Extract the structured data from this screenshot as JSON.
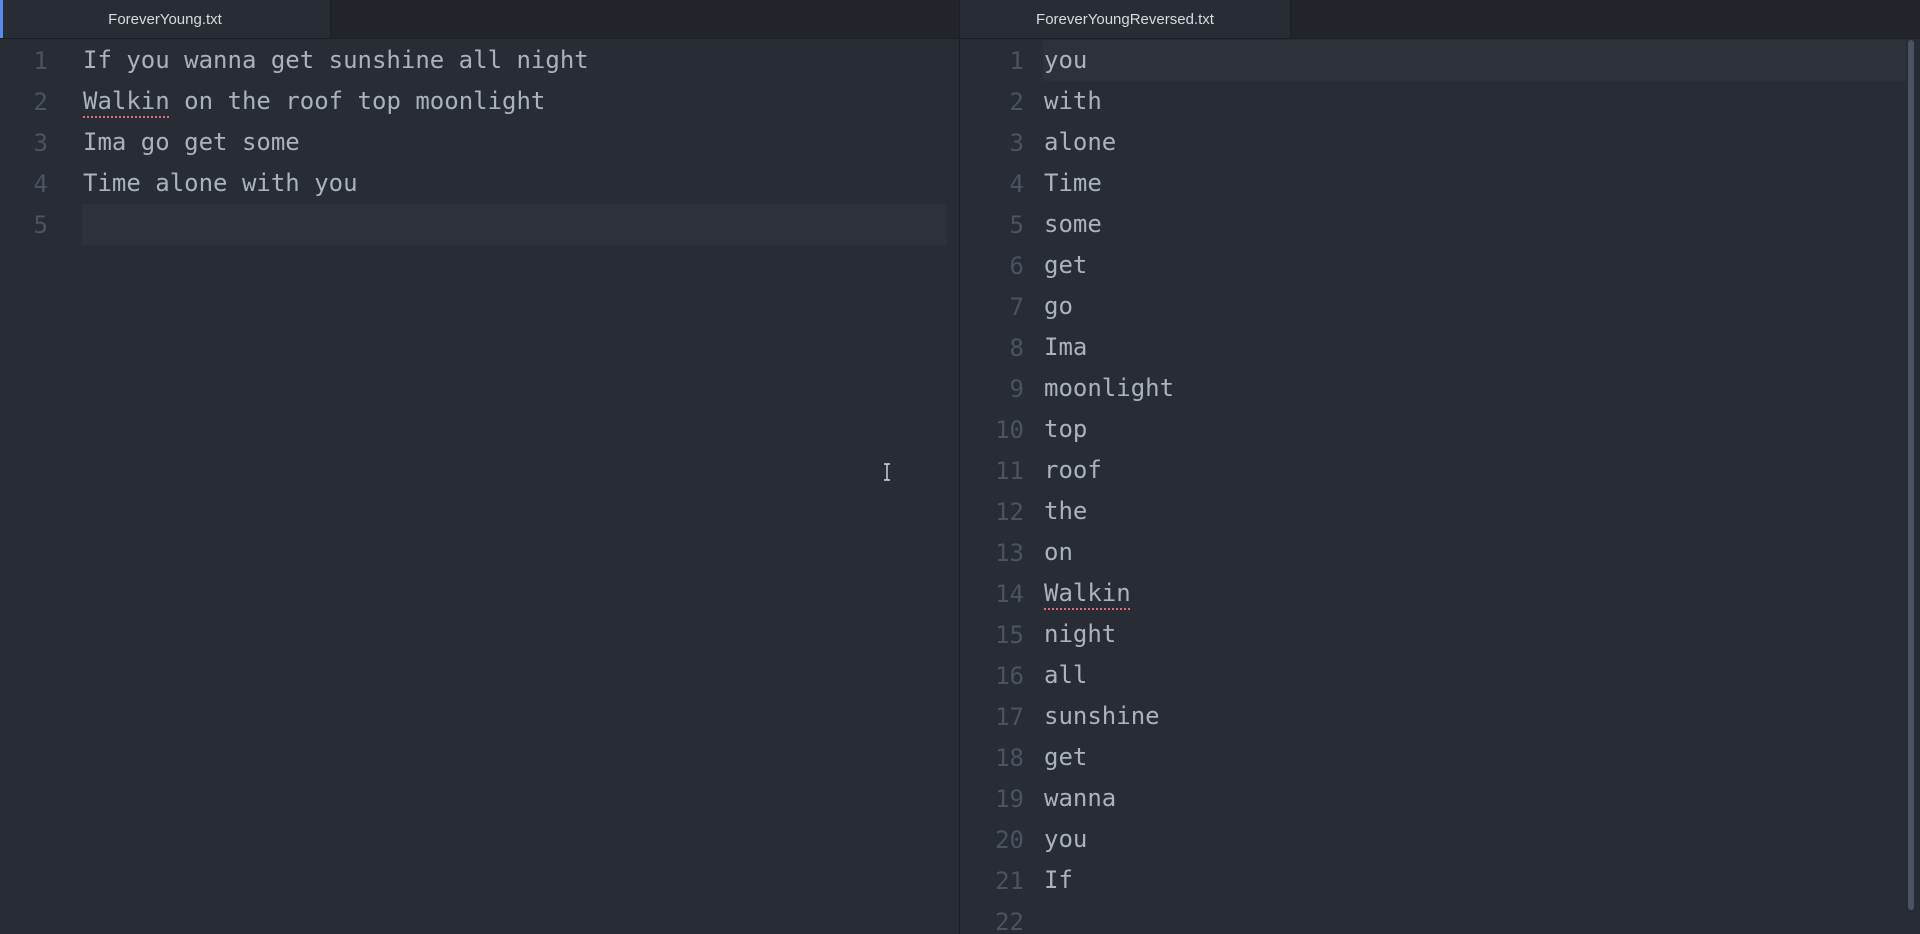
{
  "left_pane": {
    "tab_label": "ForeverYoung.txt",
    "lines": [
      {
        "num": "1",
        "text": "If you wanna get sunshine all night"
      },
      {
        "num": "2",
        "text_spell": "Walkin",
        "text_rest": " on the roof top moonlight"
      },
      {
        "num": "3",
        "text": "Ima go get some"
      },
      {
        "num": "4",
        "text": "Time alone with you"
      },
      {
        "num": "5",
        "text": ""
      }
    ]
  },
  "right_pane": {
    "tab_label": "ForeverYoungReversed.txt",
    "lines": [
      {
        "num": "1",
        "text": "you"
      },
      {
        "num": "2",
        "text": "with"
      },
      {
        "num": "3",
        "text": "alone"
      },
      {
        "num": "4",
        "text": "Time"
      },
      {
        "num": "5",
        "text": "some"
      },
      {
        "num": "6",
        "text": "get"
      },
      {
        "num": "7",
        "text": "go"
      },
      {
        "num": "8",
        "text": "Ima"
      },
      {
        "num": "9",
        "text": "moonlight"
      },
      {
        "num": "10",
        "text": "top"
      },
      {
        "num": "11",
        "text": "roof"
      },
      {
        "num": "12",
        "text": "the"
      },
      {
        "num": "13",
        "text": "on"
      },
      {
        "num": "14",
        "text_spell": "Walkin"
      },
      {
        "num": "15",
        "text": "night"
      },
      {
        "num": "16",
        "text": "all"
      },
      {
        "num": "17",
        "text": "sunshine"
      },
      {
        "num": "18",
        "text": "get"
      },
      {
        "num": "19",
        "text": "wanna"
      },
      {
        "num": "20",
        "text": "you"
      },
      {
        "num": "21",
        "text": "If"
      },
      {
        "num": "22",
        "text": ""
      }
    ]
  },
  "colors": {
    "background": "#282c34",
    "tab_bar": "#21252b",
    "text": "#abb2bf",
    "gutter": "#4b5363",
    "active_tab_accent": "#568af2",
    "spell_underline": "#e06c75"
  },
  "icons": {
    "mouse": "text-cursor-ibeam-icon"
  }
}
